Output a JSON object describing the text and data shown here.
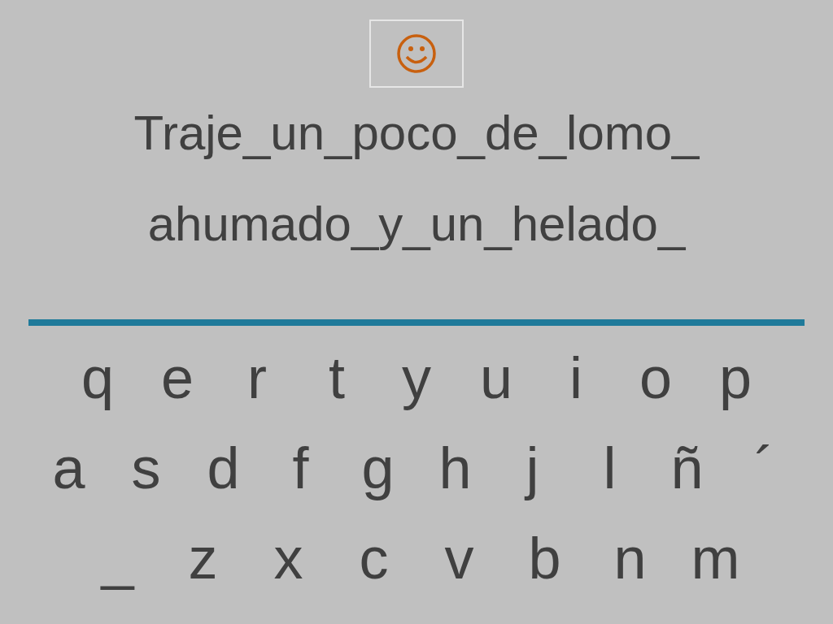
{
  "sentence_lines": [
    "Traje_un_poco_de_lomo_",
    "ahumado_y_un_helado_"
  ],
  "keyboard_rows": [
    [
      "q",
      "e",
      "r",
      "t",
      "y",
      "u",
      "i",
      "o",
      "p"
    ],
    [
      "a",
      "s",
      "d",
      "f",
      "g",
      "h",
      "j",
      "l",
      "ñ",
      "´"
    ],
    [
      "_",
      "z",
      "x",
      "c",
      "v",
      "b",
      "n",
      "m"
    ]
  ]
}
